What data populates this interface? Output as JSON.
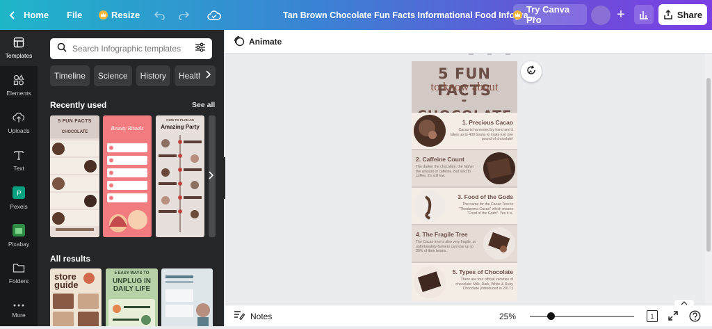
{
  "topbar": {
    "home_label": "Home",
    "file_label": "File",
    "resize_label": "Resize",
    "doc_title": "Tan Brown Chocolate Fun Facts Informational Food Infogra...",
    "try_pro_label": "Try Canva Pro",
    "share_label": "Share"
  },
  "rail": {
    "items": [
      {
        "label": "Templates",
        "icon": "templates-icon"
      },
      {
        "label": "Elements",
        "icon": "elements-icon"
      },
      {
        "label": "Uploads",
        "icon": "upload-icon"
      },
      {
        "label": "Text",
        "icon": "text-icon"
      },
      {
        "label": "Pexels",
        "icon": "pexels-icon"
      },
      {
        "label": "Pixabay",
        "icon": "pixabay-icon"
      },
      {
        "label": "Folders",
        "icon": "folder-icon"
      },
      {
        "label": "More",
        "icon": "more-icon"
      }
    ]
  },
  "panel": {
    "search_placeholder": "Search Infographic templates",
    "chips": [
      "Timeline",
      "Science",
      "History",
      "Health"
    ],
    "recently_used": "Recently used",
    "see_all": "See all",
    "all_results": "All results",
    "recent_thumbs": [
      {
        "title": "5 FUN FACTS",
        "subtitle": "CHOCOLATE",
        "bg": "#d8cdc8",
        "accent": "#6b4a3a"
      },
      {
        "title": "Beauty Rituals",
        "subtitle": "",
        "bg": "#f27b7f",
        "accent": "#ffffff"
      },
      {
        "title": "Amazing Party",
        "subtitle": "HOW TO PLAN AN",
        "bg": "#e6dfdc",
        "accent": "#5a3d36"
      }
    ],
    "result_thumbs": [
      {
        "title": "store guide",
        "bg": "#efe3d3",
        "accent": "#4a2e25"
      },
      {
        "title": "UNPLUG IN DAILY LIFE",
        "subtitle": "5 EASY WAYS TO",
        "bg": "#b8d2a8",
        "accent": "#2f4a33"
      },
      {
        "title": "",
        "bg": "#dfe6ea",
        "accent": "#5d7d8a"
      }
    ]
  },
  "subbar": {
    "animate_label": "Animate"
  },
  "infographic": {
    "line1": "5 FUN FACTS",
    "line2": "to know about",
    "line3": "- CHOCOLATE -",
    "facts": [
      {
        "title": "1. Precious Cacao",
        "body": "Cacao is harvested by hand and it takes up to 400 beans to make just one pound of chocolate!"
      },
      {
        "title": "2. Caffeine Count",
        "body": "The darker the chocolate, the higher the amount of caffeine. But next to coffee, it's still low."
      },
      {
        "title": "3. Food of the Gods",
        "body": "The name for the Cacao Tree is \"Theobroma Cacao\" which means \"Food of the Gods\". Yes it is."
      },
      {
        "title": "4. The Fragile Tree",
        "body": "The Cacao tree is also very fragile, so unfortunately farmers can lose up to 30% of their beans."
      },
      {
        "title": "5. Types of Chocolate",
        "body": "There are four official varieties of chocolate: Milk, Dark, White & Ruby Chocolate (introduced in 2017.)"
      }
    ]
  },
  "botbar": {
    "notes_label": "Notes",
    "zoom_label": "25%",
    "page_count": "1",
    "zoom_fraction": 0.25
  },
  "colors": {
    "bg_cream": "#f3ede6",
    "brown": "#6b4a3a",
    "panel": "#252627"
  }
}
